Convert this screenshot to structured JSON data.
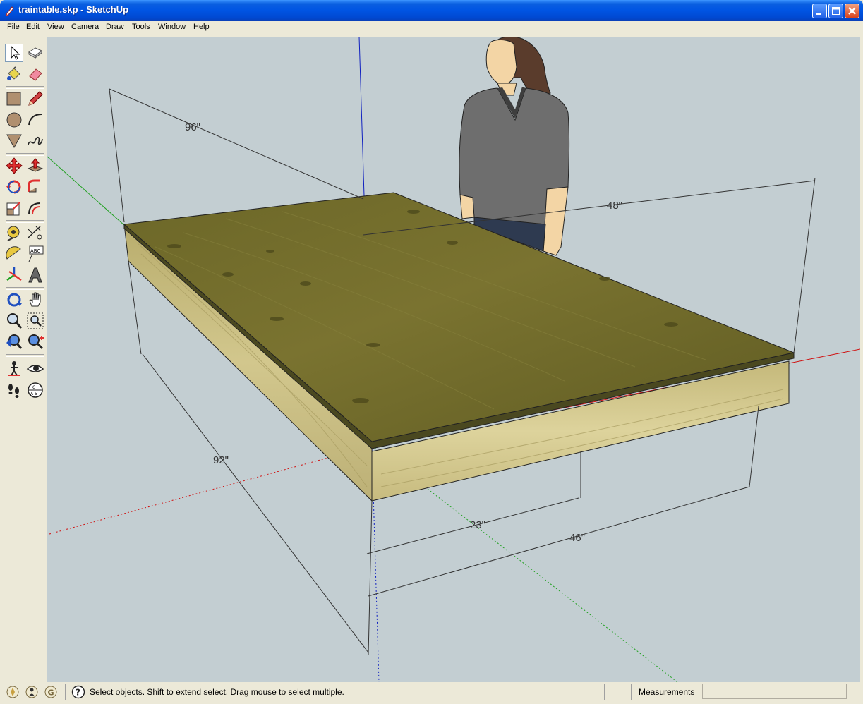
{
  "window": {
    "title": "traintable.skp - SketchUp"
  },
  "menu": [
    "File",
    "Edit",
    "View",
    "Camera",
    "Draw",
    "Tools",
    "Window",
    "Help"
  ],
  "tools": [
    "select",
    "make-component",
    "paint-bucket",
    "eraser",
    "rectangle",
    "line",
    "circle",
    "arc",
    "polygon",
    "freehand",
    "move",
    "push-pull",
    "rotate",
    "follow-me",
    "scale",
    "offset",
    "tape-measure",
    "dimension",
    "protractor",
    "text",
    "axes",
    "3d-text",
    "orbit",
    "pan",
    "zoom",
    "zoom-window",
    "previous-view",
    "zoom-extents",
    "position-camera",
    "look-around",
    "walk",
    "section-plane"
  ],
  "active_tool": "select",
  "model": {
    "dimensions": {
      "length": "96\"",
      "width": "48\"",
      "left_depth": "92\"",
      "half_front": "23\"",
      "front": "46\""
    },
    "colors": {
      "background": "#c3ced2",
      "top_surface": "#6f6a2c",
      "frame_wood": "#c9bd82",
      "red_axis": "#d01010",
      "green_axis": "#20a020",
      "blue_axis": "#1020c0"
    }
  },
  "statusbar": {
    "hint": "Select objects. Shift to extend select. Drag mouse to select multiple.",
    "measurements_label": "Measurements",
    "measurements_value": ""
  }
}
